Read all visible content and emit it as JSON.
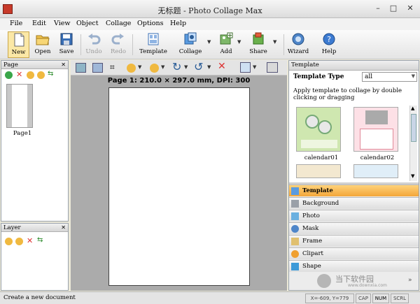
{
  "window": {
    "title": "无标题 - Photo Collage Max"
  },
  "menu": [
    "File",
    "Edit",
    "View",
    "Object",
    "Collage",
    "Options",
    "Help"
  ],
  "toolbar": {
    "new": "New",
    "open": "Open",
    "save": "Save",
    "undo": "Undo",
    "redo": "Redo",
    "template": "Template",
    "collage": "Collage",
    "add": "Add",
    "share": "Share",
    "wizard": "Wizard",
    "help": "Help"
  },
  "page_panel": {
    "title": "Page",
    "page_label": "Page1"
  },
  "layer_panel": {
    "title": "Layer"
  },
  "canvas": {
    "page_info": "Page 1: 210.0 × 297.0 mm, DPI: 300"
  },
  "template_panel": {
    "title": "Template",
    "type_label": "Template Type",
    "type_value": "all",
    "hint": "Apply template to collage by double clicking or dragging",
    "thumbs": [
      "calendar01",
      "calendar02"
    ]
  },
  "accordion": [
    "Template",
    "Background",
    "Photo",
    "Mask",
    "Frame",
    "Clipart",
    "Shape"
  ],
  "status": {
    "message": "Create a new document",
    "coords": "X=-609, Y=779",
    "cap": "CAP",
    "num": "NUM",
    "scrl": "SCRL"
  },
  "watermark": {
    "cn": "当下软件园",
    "site": "www.downxia.com"
  },
  "colors": {
    "accent": "#f3a63a",
    "canvas_bg": "#ababab",
    "title_red": "#c73a2a"
  }
}
